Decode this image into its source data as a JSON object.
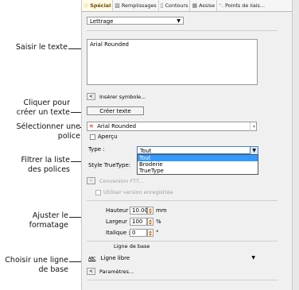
{
  "callouts": {
    "saisir": "Saisir le texte",
    "cliquer_1": "Cliquer pour",
    "cliquer_2": "créer un texte",
    "selectionner_1": "Sélectionner une",
    "selectionner_2": "police",
    "filtrer_1": "Filtrer la liste",
    "filtrer_2": "des polices",
    "ajuster_1": "Ajuster le",
    "ajuster_2": "formatage",
    "choisir_1": "Choisir une ligne",
    "choisir_2": "de base"
  },
  "tabs": [
    {
      "label": "Spécial",
      "icon": "star-icon"
    },
    {
      "label": "Remplissages",
      "icon": "fill-icon"
    },
    {
      "label": "Contours",
      "icon": "outline-icon"
    },
    {
      "label": "Assise",
      "icon": "underlay-icon"
    },
    {
      "label": "Points de liais...",
      "icon": "tie-points-icon"
    }
  ],
  "object_type": {
    "value": "Lettrage"
  },
  "text_input": {
    "value": "Arial Rounded"
  },
  "insert_symbol": {
    "button": "<",
    "label": "Insérer symbole..."
  },
  "create_text": {
    "label": "Créer texte"
  },
  "font": {
    "value": "Arial Rounded",
    "icon": "font-icon"
  },
  "preview": {
    "label": "Aperçu",
    "checked": false
  },
  "type": {
    "label": "Type :",
    "value": "Tout",
    "options": [
      "Tout",
      "Broderie",
      "TrueType"
    ],
    "selected": "Tout"
  },
  "style_truetype": {
    "label": "Style TrueType:"
  },
  "conversion": {
    "button": "<",
    "label": "Conversion FTT..."
  },
  "saved_version": {
    "label": "Utiliser version enregistrée"
  },
  "formatting": {
    "height": {
      "label": "Hauteur :",
      "value": "10.00",
      "unit": "mm"
    },
    "width": {
      "label": "Largeur :",
      "value": "100",
      "unit": "%"
    },
    "italic": {
      "label": "Italique :",
      "value": "0",
      "unit": "°"
    }
  },
  "baseline": {
    "section_label": "Ligne de base",
    "value": "Ligne libre",
    "icon_text": "ABC"
  },
  "parameters": {
    "button": "<",
    "label": "Paramètres..."
  },
  "colors": {
    "accent": "#d46a00",
    "selection": "#3399ff",
    "panel": "#f0f0f0"
  }
}
